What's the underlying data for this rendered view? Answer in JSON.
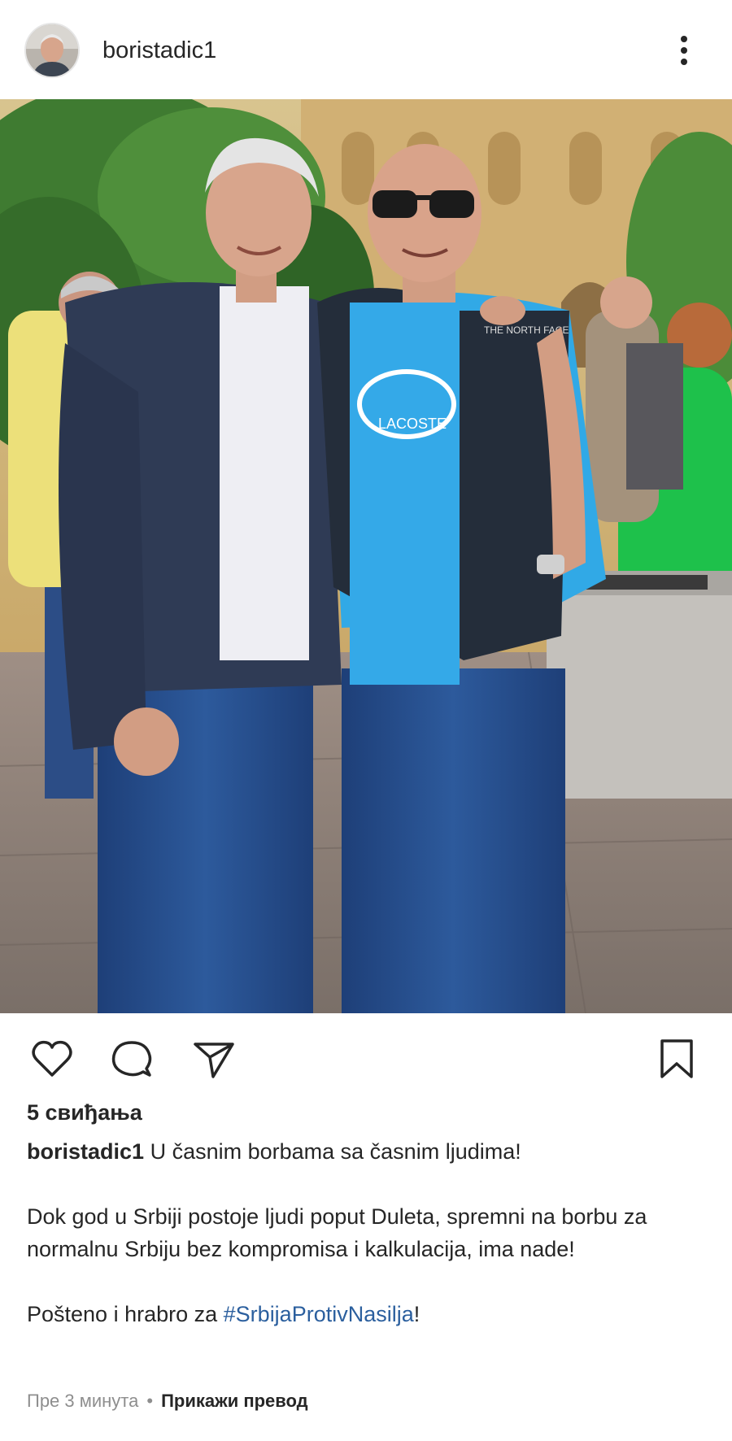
{
  "post": {
    "username": "boristadic1",
    "likes_text": "5 свиђања",
    "caption": {
      "username": "boristadic1",
      "line1": "U časnim borbama sa časnim ljudima!",
      "para2": "Dok god u Srbiji postoje ljudi poput Duleta, spremni na borbu za normalnu Srbiju bez kompromisa i kalkulacija, ima nade!",
      "para3_prefix": "Pošteno i hrabro za ",
      "hashtag": "#SrbijaProtivNasilja",
      "para3_suffix": "!"
    },
    "time_text": "Пре 3 минута",
    "separator": "•",
    "translate_text": "Прикажи превод"
  },
  "icons": {
    "more": "more-vertical-icon",
    "like": "heart-icon",
    "comment": "comment-icon",
    "share": "send-icon",
    "save": "bookmark-icon"
  },
  "colors": {
    "text": "#262626",
    "secondary": "#8e8e8e",
    "hashtag": "#2b5f9e"
  },
  "photo": {
    "shirt_print": "LACOSTE",
    "vest_logo": "THE NORTH FACE"
  }
}
